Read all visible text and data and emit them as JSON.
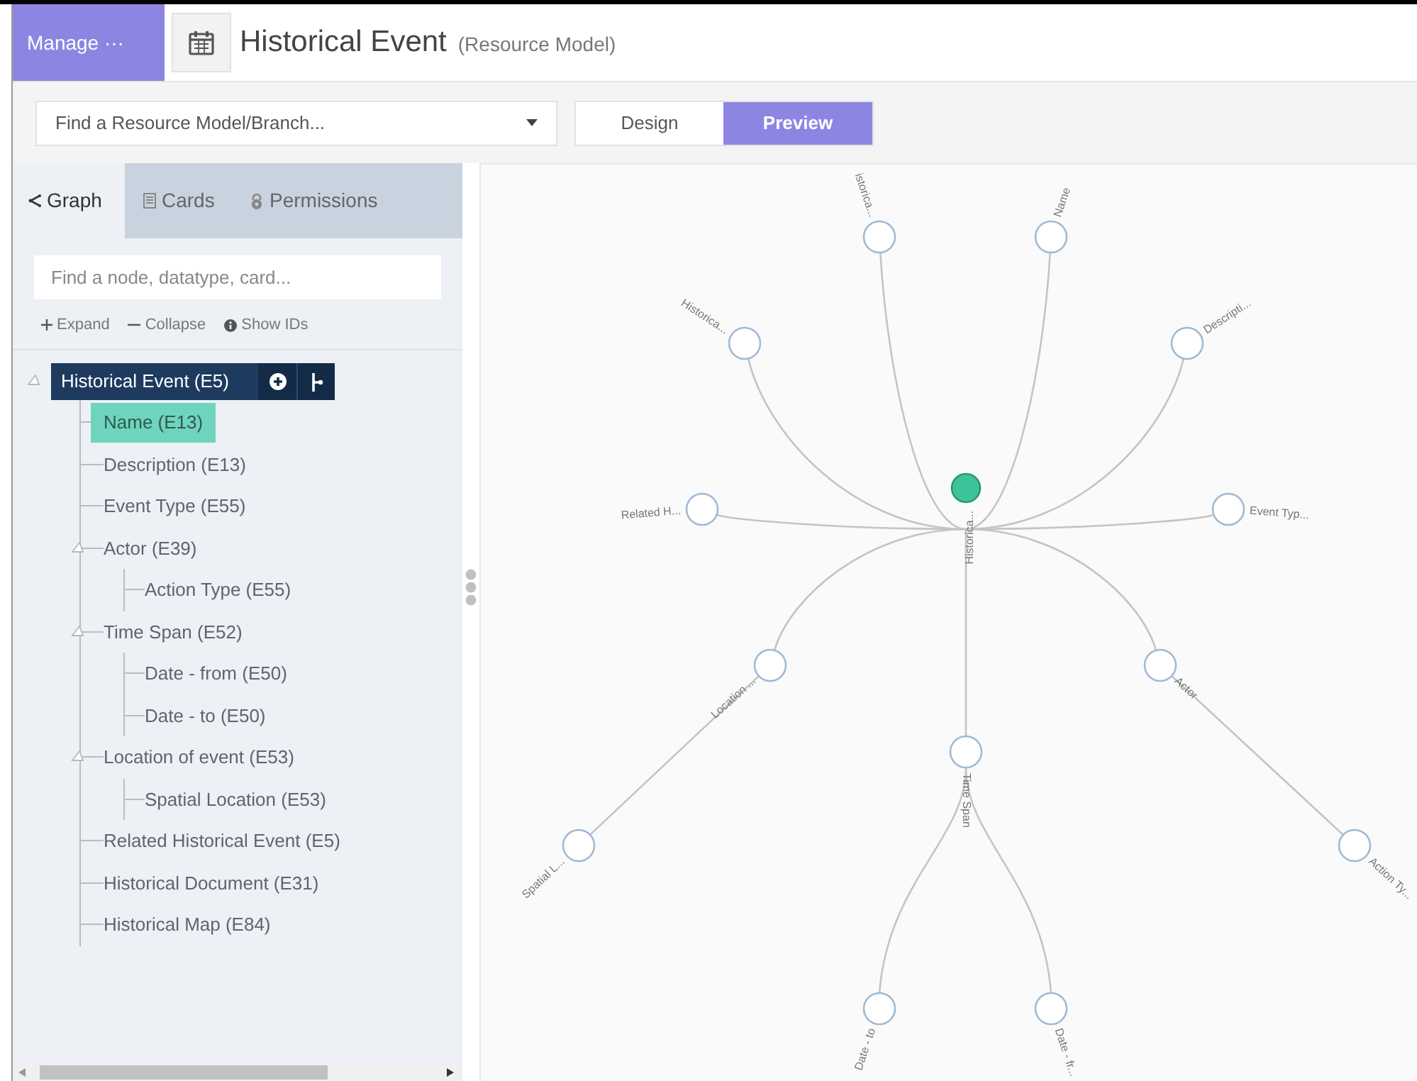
{
  "header": {
    "manage_button": "Manage ···",
    "title": "Historical Event",
    "subtitle": "(Resource Model)"
  },
  "toolbar": {
    "model_select": {
      "placeholder": "Find a Resource Model/Branch..."
    },
    "modes": [
      {
        "label": "Design",
        "selected": false
      },
      {
        "label": "Preview",
        "selected": true
      }
    ]
  },
  "panel_tabs": [
    {
      "label": "Graph",
      "kind": "graph",
      "selected": true
    },
    {
      "label": "Cards",
      "kind": "cards",
      "selected": false
    },
    {
      "label": "Permissions",
      "kind": "permissions",
      "selected": false
    }
  ],
  "node_search": {
    "placeholder": "Find a node, datatype, card..."
  },
  "tree_actions": [
    {
      "label": "Expand",
      "kind": "expand"
    },
    {
      "label": "Collapse",
      "kind": "collapse"
    },
    {
      "label": "Show IDs",
      "kind": "ids"
    }
  ],
  "tree": {
    "root": {
      "label": "Historical Event (E5)",
      "children": [
        {
          "label": "Name (E13)",
          "selected": true
        },
        {
          "label": "Description (E13)",
          "selected": false
        },
        {
          "label": "Event Type (E55)",
          "selected": false
        },
        {
          "label": "Actor (E39)",
          "selected": false,
          "children": [
            {
              "label": "Action Type (E55)",
              "selected": false
            }
          ]
        },
        {
          "label": "Time Span (E52)",
          "selected": false,
          "children": [
            {
              "label": "Date - from (E50)",
              "selected": false
            },
            {
              "label": "Date - to (E50)",
              "selected": false
            }
          ]
        },
        {
          "label": "Location of event (E53)",
          "selected": false,
          "children": [
            {
              "label": "Spatial Location (E53)",
              "selected": false
            }
          ]
        },
        {
          "label": "Related Historical Event (E5)",
          "selected": false
        },
        {
          "label": "Historical Document (E31)",
          "selected": false
        },
        {
          "label": "Historical Map (E84)",
          "selected": false
        }
      ]
    }
  },
  "graph": {
    "root": {
      "label": "Historica...",
      "selected": true,
      "children": [
        {
          "label": "Name",
          "selected": false
        },
        {
          "label": "Descripti...",
          "selected": false
        },
        {
          "label": "Event Typ...",
          "selected": false
        },
        {
          "label": "Actor",
          "selected": false,
          "children": [
            {
              "label": "Action Ty...",
              "selected": false
            }
          ]
        },
        {
          "label": "Time Span",
          "selected": false,
          "children": [
            {
              "label": "Date - fr...",
              "selected": false
            },
            {
              "label": "Date - to",
              "selected": false
            }
          ]
        },
        {
          "label": "Location ...",
          "selected": false,
          "children": [
            {
              "label": "Spatial L...",
              "selected": false
            }
          ]
        },
        {
          "label": "Related H...",
          "selected": false
        },
        {
          "label": "Historica...",
          "selected": false
        },
        {
          "label": "istorica...",
          "selected": false
        }
      ]
    }
  }
}
